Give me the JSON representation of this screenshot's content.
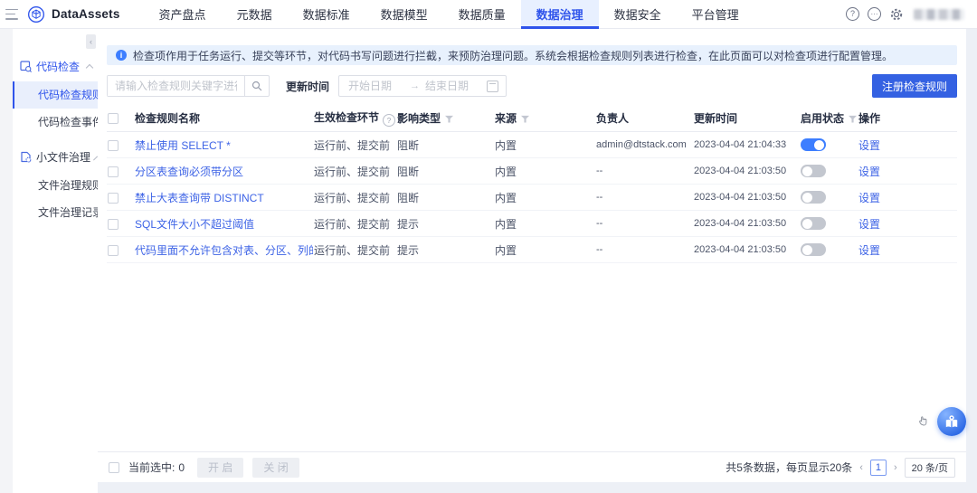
{
  "colors": {
    "accent": "#2f54eb",
    "primary_button": "#3461e2",
    "toggle_on": "#3d7eff",
    "banner_bg": "#e8f1fd",
    "link": "#3d63e6"
  },
  "header": {
    "brand": "DataAssets",
    "nav": [
      {
        "label": "资产盘点",
        "active": false
      },
      {
        "label": "元数据",
        "active": false
      },
      {
        "label": "数据标准",
        "active": false
      },
      {
        "label": "数据模型",
        "active": false
      },
      {
        "label": "数据质量",
        "active": false
      },
      {
        "label": "数据治理",
        "active": true
      },
      {
        "label": "数据安全",
        "active": false
      },
      {
        "label": "平台管理",
        "active": false
      }
    ],
    "icons": [
      "help-icon",
      "message-icon",
      "settings-gear-icon",
      "user-avatar-blurred"
    ]
  },
  "sidebar": {
    "groups": [
      {
        "label": "代码检查",
        "icon": "code-check-icon",
        "active": true,
        "items": [
          {
            "label": "代码检查规则",
            "active": true
          },
          {
            "label": "代码检查事件",
            "active": false
          }
        ]
      },
      {
        "label": "小文件治理",
        "icon": "file-governance-icon",
        "active": false,
        "items": [
          {
            "label": "文件治理规则",
            "active": false
          },
          {
            "label": "文件治理记录",
            "active": false
          }
        ]
      }
    ]
  },
  "banner": {
    "text": "检查项作用于任务运行、提交等环节，对代码书写问题进行拦截，来预防治理问题。系统会根据检查规则列表进行检查，在此页面可以对检查项进行配置管理。"
  },
  "filters": {
    "search_placeholder": "请输入检查规则关键字进行搜索",
    "update_time_label": "更新时间",
    "start_date_placeholder": "开始日期",
    "end_date_placeholder": "结束日期",
    "register_button": "注册检查规则"
  },
  "table": {
    "columns": [
      {
        "label": "检查规则名称",
        "icon": ""
      },
      {
        "label": "生效检查环节",
        "icon": "question-circle-icon"
      },
      {
        "label": "影响类型",
        "icon": "filter-icon"
      },
      {
        "label": "来源",
        "icon": "filter-icon"
      },
      {
        "label": "负责人",
        "icon": ""
      },
      {
        "label": "更新时间",
        "icon": ""
      },
      {
        "label": "启用状态",
        "icon": "filter-icon"
      },
      {
        "label": "操作",
        "icon": ""
      }
    ],
    "rows": [
      {
        "name": "禁止使用 SELECT *",
        "stage": "运行前、提交前",
        "impact": "阻断",
        "source": "内置",
        "owner": "admin@dtstack.com",
        "updated": "2023-04-04 21:04:33",
        "enabled": true,
        "action": "设置"
      },
      {
        "name": "分区表查询必须带分区",
        "stage": "运行前、提交前",
        "impact": "阻断",
        "source": "内置",
        "owner": "--",
        "updated": "2023-04-04 21:03:50",
        "enabled": false,
        "action": "设置"
      },
      {
        "name": "禁止大表查询带 DISTINCT",
        "stage": "运行前、提交前",
        "impact": "阻断",
        "source": "内置",
        "owner": "--",
        "updated": "2023-04-04 21:03:50",
        "enabled": false,
        "action": "设置"
      },
      {
        "name": "SQL文件大小不超过阈值",
        "stage": "运行前、提交前",
        "impact": "提示",
        "source": "内置",
        "owner": "--",
        "updated": "2023-04-04 21:03:50",
        "enabled": false,
        "action": "设置"
      },
      {
        "name": "代码里面不允许包含对表、分区、列的DDL 语句，除了新...",
        "stage": "运行前、提交前",
        "impact": "提示",
        "source": "内置",
        "owner": "--",
        "updated": "2023-04-04 21:03:50",
        "enabled": false,
        "action": "设置"
      }
    ]
  },
  "footer": {
    "selected_label": "当前选中:",
    "selected_count": "0",
    "enable_button": "开 启",
    "disable_button": "关 闭",
    "total_text": "共5条数据，每页显示20条",
    "prev_label": "‹",
    "next_label": "›",
    "current_page": "1",
    "page_size": "20 条/页"
  }
}
